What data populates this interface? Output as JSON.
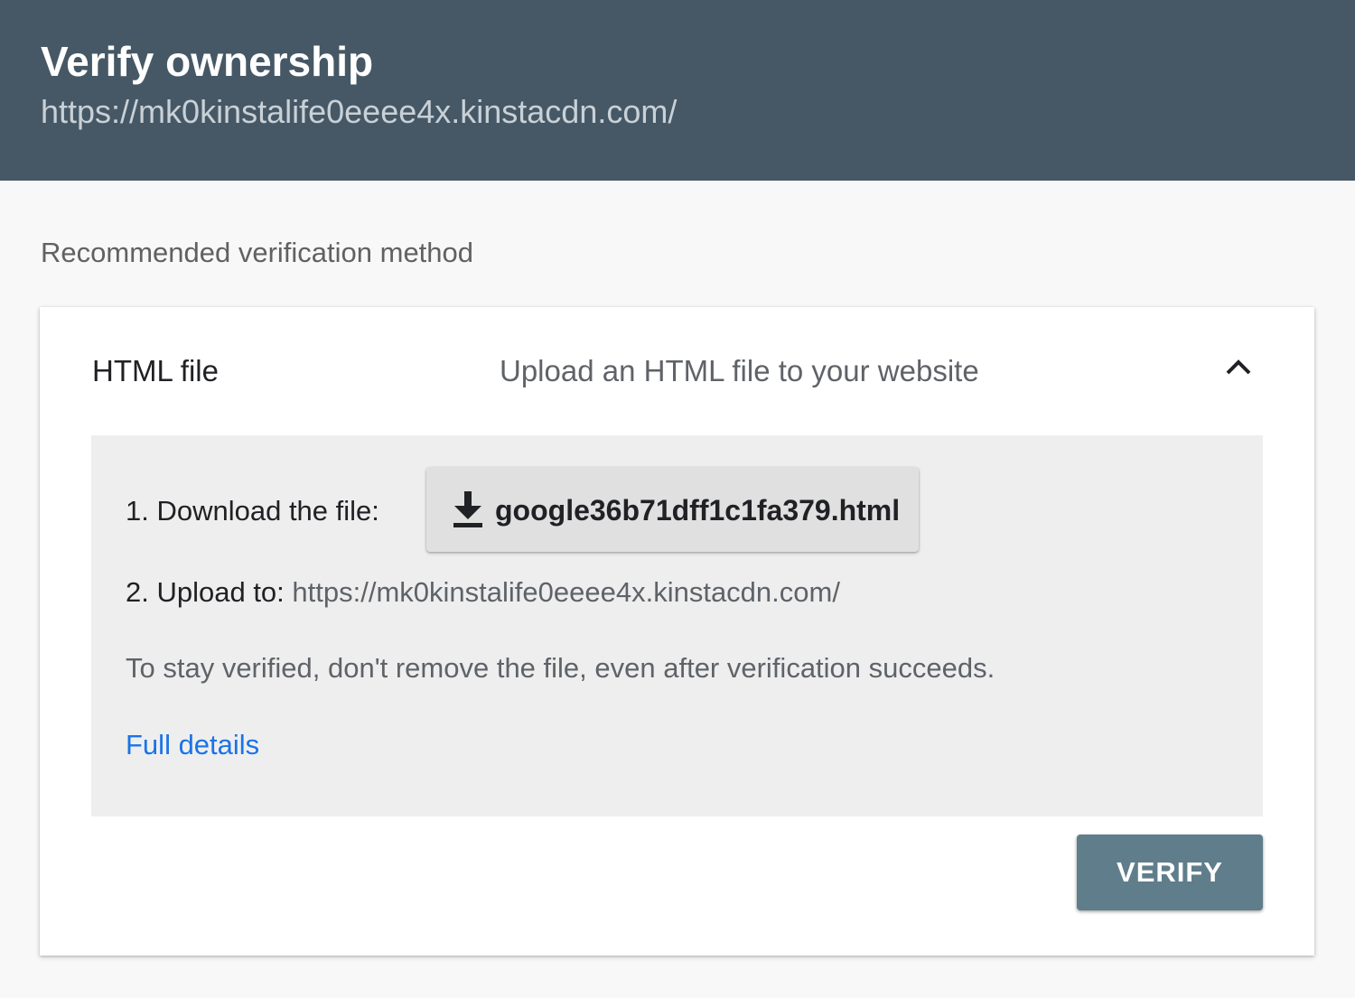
{
  "header": {
    "title": "Verify ownership",
    "url": "https://mk0kinstalife0eeee4x.kinstacdn.com/"
  },
  "section_label": "Recommended verification method",
  "method": {
    "name": "HTML file",
    "description": "Upload an HTML file to your website",
    "toggle_icon": "chevron-up-icon"
  },
  "steps": {
    "step1_label": "1. Download the file:",
    "download_icon": "download-icon",
    "download_filename": "google36b71dff1c1fa379.html",
    "step2_label": "2. Upload to:",
    "step2_url": "https://mk0kinstalife0eeee4x.kinstacdn.com/",
    "note": "To stay verified, don't remove the file, even after verification succeeds.",
    "full_details_link": "Full details"
  },
  "verify_button": "VERIFY",
  "colors": {
    "header_bg": "#465866",
    "link": "#1a73e8",
    "verify_bg": "#607d8b",
    "panel_bg": "#eeeeee"
  }
}
